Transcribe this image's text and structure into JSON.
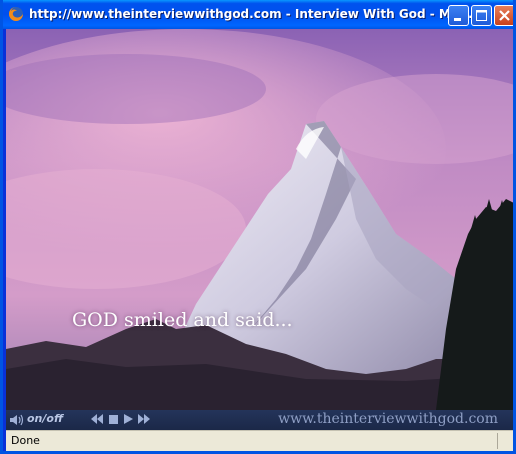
{
  "window": {
    "title": "http://www.theinterviewwithgod.com - Interview With God - Mo...",
    "app_icon": "firefox-icon",
    "buttons": [
      "minimize",
      "maximize",
      "close"
    ]
  },
  "content": {
    "caption": "GOD smiled and said..."
  },
  "player": {
    "toggle_label": "on/off",
    "controls": [
      "rewind",
      "stop",
      "play",
      "fast-forward"
    ],
    "site_url": "www.theinterviewwithgod.com"
  },
  "status": {
    "text": "Done"
  },
  "colors": {
    "titlebar": "#0054e3",
    "sky": "#b88ab5",
    "player_bar": "#1f2d50",
    "statusbar": "#ece9d8"
  }
}
